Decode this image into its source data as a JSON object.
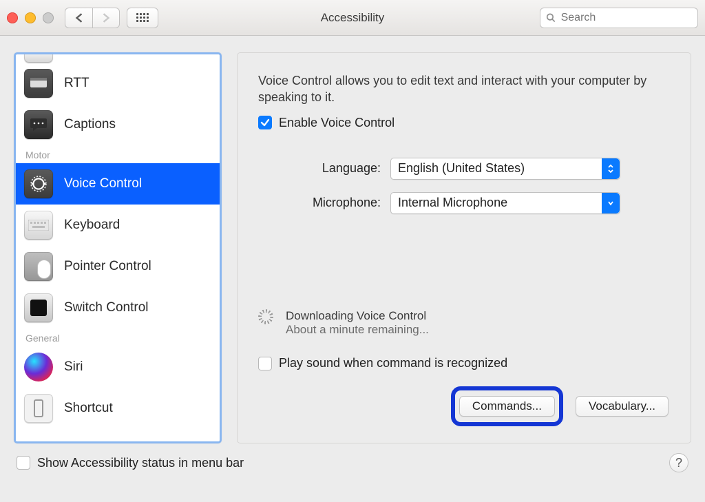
{
  "window": {
    "title": "Accessibility",
    "search_placeholder": "Search"
  },
  "sidebar": {
    "items": [
      {
        "group": null,
        "label": "RTT",
        "icon": "rtt"
      },
      {
        "group": null,
        "label": "Captions",
        "icon": "captions"
      },
      {
        "group": "Motor",
        "label": "Voice Control",
        "icon": "voice",
        "selected": true
      },
      {
        "group": null,
        "label": "Keyboard",
        "icon": "kbd"
      },
      {
        "group": null,
        "label": "Pointer Control",
        "icon": "pointer"
      },
      {
        "group": null,
        "label": "Switch Control",
        "icon": "switch"
      },
      {
        "group": "General",
        "label": "Siri",
        "icon": "siri"
      },
      {
        "group": null,
        "label": "Shortcut",
        "icon": "shortcut"
      }
    ],
    "cat_motor": "Motor",
    "cat_general": "General"
  },
  "panel": {
    "description": "Voice Control allows you to edit text and interact with your computer by speaking to it.",
    "enable_label": "Enable Voice Control",
    "enable_checked": true,
    "language_label": "Language:",
    "language_value": "English (United States)",
    "microphone_label": "Microphone:",
    "microphone_value": "Internal Microphone",
    "download_title": "Downloading Voice Control",
    "download_sub": "About a minute remaining...",
    "playsound_label": "Play sound when command is recognized",
    "playsound_checked": false,
    "commands_btn": "Commands...",
    "vocabulary_btn": "Vocabulary..."
  },
  "footer": {
    "status_label": "Show Accessibility status in menu bar",
    "status_checked": false,
    "help": "?"
  }
}
